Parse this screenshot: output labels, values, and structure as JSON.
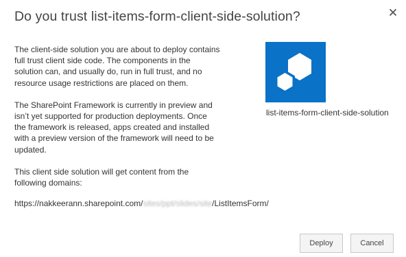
{
  "dialog": {
    "title": "Do you trust list-items-form-client-side-solution?",
    "close_icon": "close-icon"
  },
  "body": {
    "paragraph1": "The client-side solution you are about to deploy contains full trust client side code. The components in the solution can, and usually do, run in full trust, and no resource usage restrictions are placed on them.",
    "paragraph2": "The SharePoint Framework is currently in preview and isn’t yet supported for production deployments. Once the framework is released, apps created and installed with a preview version of the framework will need to be updated.",
    "paragraph3": "This client side solution will get content from the following domains:",
    "domain_prefix": "https://nakkeerann.sharepoint.com/",
    "domain_obscured": "sites/ppt/slides/site",
    "domain_suffix": "/ListItemsForm/"
  },
  "app": {
    "name": "list-items-form-client-side-solution",
    "icon": "app-hexagon-icon",
    "tile_color": "#0a72c7"
  },
  "buttons": {
    "deploy_label": "Deploy",
    "cancel_label": "Cancel"
  }
}
